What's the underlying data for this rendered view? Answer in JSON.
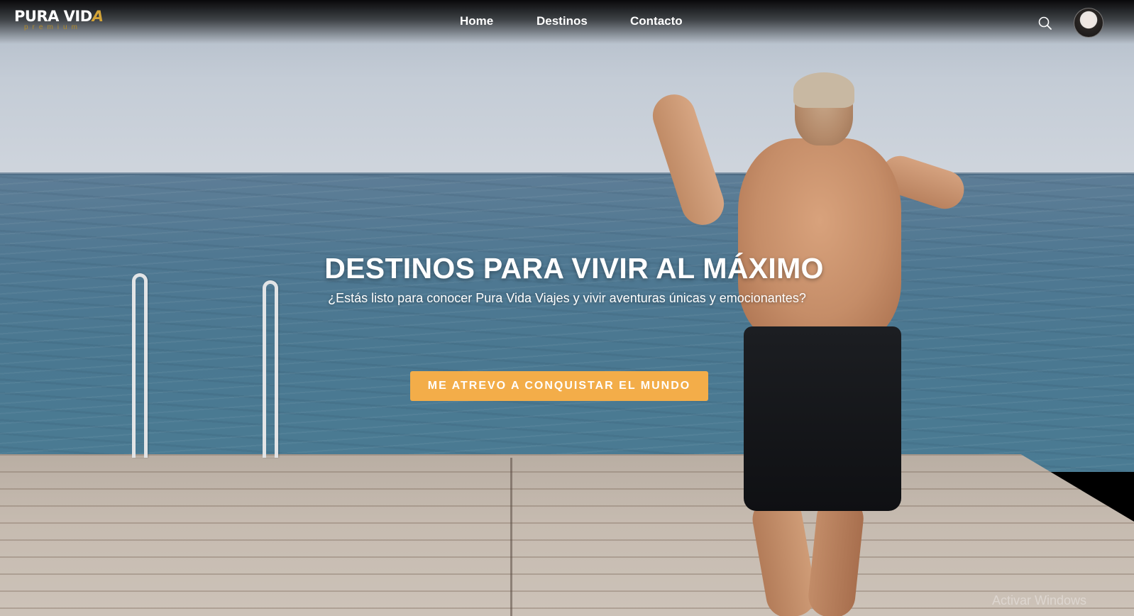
{
  "brand": {
    "name_main": "PURA VID",
    "name_accent": "A",
    "sub": "premium",
    "accent_color": "#d4a437"
  },
  "nav": {
    "links": [
      {
        "label": "Home"
      },
      {
        "label": "Destinos"
      },
      {
        "label": "Contacto"
      }
    ],
    "search_icon": "search-icon",
    "avatar_icon": "user-avatar"
  },
  "hero": {
    "title": "DESTINOS PARA VIVIR AL MÁXIMO",
    "subtitle": "¿Estás listo para conocer Pura Vida Viajes y vivir aventuras únicas y emocionantes?",
    "cta_label": "ME ATREVO A CONQUISTAR EL MUNDO",
    "cta_color": "#f3ad49"
  },
  "watermark": "Activar Windows"
}
